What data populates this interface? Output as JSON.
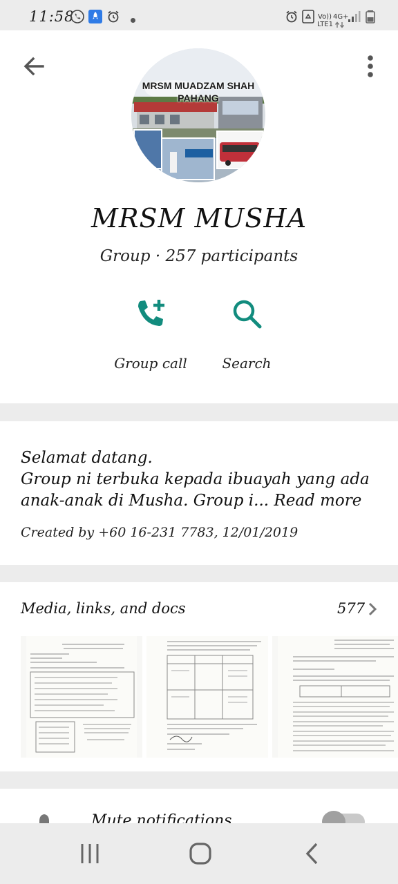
{
  "status_bar": {
    "time": "11:58",
    "carrier_top": "Vo))",
    "carrier_bottom": "LTE1",
    "network": "4G+"
  },
  "header": {
    "avatar_title_line1": "MRSM MUADZAM SHAH",
    "avatar_title_line2": "PAHANG",
    "group_name": "MRSM MUSHA",
    "group_subtitle": "Group · 257 participants",
    "actions": [
      {
        "label": "Group call",
        "icon": "add-call-icon"
      },
      {
        "label": "Search",
        "icon": "search-icon"
      }
    ]
  },
  "description": {
    "line1": "Selamat datang.",
    "line2": "Group ni terbuka kepada ibuayah yang ada",
    "line3": "anak-anak di Musha. Group i...",
    "read_more": "Read more",
    "created": "Created by +60 16-231 7783, 12/01/2019"
  },
  "media": {
    "label": "Media, links, and docs",
    "count": "577"
  },
  "mute": {
    "label": "Mute notifications"
  },
  "colors": {
    "accent": "#128c7e",
    "background": "#ececec",
    "card": "#ffffff"
  }
}
